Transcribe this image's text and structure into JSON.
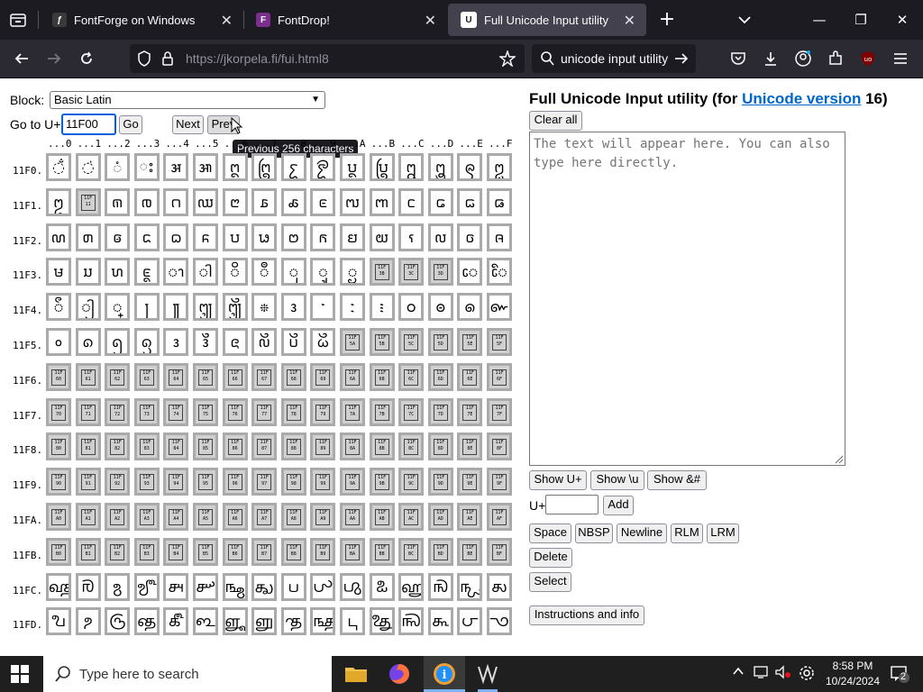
{
  "browser": {
    "tabs": [
      {
        "label": "FontForge on Windows",
        "active": false
      },
      {
        "label": "FontDrop!",
        "active": false
      },
      {
        "label": "Full Unicode Input utility",
        "active": true
      }
    ],
    "url": "https://jkorpela.fi/fui.html8",
    "search_text": "unicode input utility"
  },
  "page": {
    "block_label": "Block:",
    "block_value": "Basic Latin",
    "goto_label": "Go to U+",
    "goto_value": "11F00",
    "go_label": "Go",
    "next_label": "Next",
    "prev_label": "Prev",
    "tooltip": "Previous 256 characters",
    "col_headers": [
      "...0",
      "...1",
      "...2",
      "...3",
      "...4",
      "...5",
      "...6",
      "...7",
      "...8",
      "...9",
      "...A",
      "...B",
      "...C",
      "...D",
      "...E",
      "...F"
    ],
    "rows": [
      {
        "label": "11F0.",
        "chars": [
          "◌̐",
          "◌̇",
          "◌ံ",
          "◌ះ",
          "𑼄",
          "𑼅",
          "𑼆",
          "𑼇",
          "𑼈",
          "𑼉",
          "𑼊",
          "𑼋",
          "𑼌",
          "𑼍",
          "𑼎",
          "𑼏"
        ]
      },
      {
        "label": "11F1.",
        "chars": [
          "𑼐",
          "#11F11",
          "𑼒",
          "𑼓",
          "𑼔",
          "𑼕",
          "𑼖",
          "𑼗",
          "𑼘",
          "𑼙",
          "𑼚",
          "𑼛",
          "𑼜",
          "𑼝",
          "𑼞",
          "𑼟"
        ]
      },
      {
        "label": "11F2.",
        "chars": [
          "𑼠",
          "𑼡",
          "𑼢",
          "𑼣",
          "𑼤",
          "𑼥",
          "𑼦",
          "𑼧",
          "𑼨",
          "𑼩",
          "𑼪",
          "𑼫",
          "𑼬",
          "𑼭",
          "𑼮",
          "𑼯"
        ]
      },
      {
        "label": "11F3.",
        "chars": [
          "𑼰",
          "𑼱",
          "𑼲",
          "𑼳",
          "𑼴",
          "𑼵",
          "𑼶",
          "𑼷",
          "𑼸",
          "𑼹",
          "𑼺",
          "#11F3B",
          "#11F3C",
          "#11F3D",
          "𑼾",
          "𑼿"
        ]
      },
      {
        "label": "11F4.",
        "chars": [
          "𑽀",
          "𑽁",
          "𑽂",
          "𑽃",
          "𑽄",
          "𑽅",
          "𑽆",
          "𑽇",
          "𑽈",
          "𑽉",
          "𑽊",
          "𑽋",
          "𑽌",
          "𑽍",
          "𑽎",
          "𑽏"
        ]
      },
      {
        "label": "11F5.",
        "chars": [
          "𑽐",
          "𑽑",
          "𑽒",
          "𑽓",
          "𑽔",
          "𑽕",
          "𑽖",
          "𑽗",
          "𑽘",
          "𑽙",
          "#11F5A",
          "#11F5B",
          "#11F5C",
          "#11F5D",
          "#11F5E",
          "#11F5F"
        ]
      },
      {
        "label": "11F6.",
        "chars": [
          "#11F60",
          "#11F61",
          "#11F62",
          "#11F63",
          "#11F64",
          "#11F65",
          "#11F66",
          "#11F67",
          "#11F68",
          "#11F69",
          "#11F6A",
          "#11F6B",
          "#11F6C",
          "#11F6D",
          "#11F6E",
          "#11F6F"
        ]
      },
      {
        "label": "11F7.",
        "chars": [
          "#11F70",
          "#11F71",
          "#11F72",
          "#11F73",
          "#11F74",
          "#11F75",
          "#11F76",
          "#11F77",
          "#11F78",
          "#11F79",
          "#11F7A",
          "#11F7B",
          "#11F7C",
          "#11F7D",
          "#11F7E",
          "#11F7F"
        ]
      },
      {
        "label": "11F8.",
        "chars": [
          "#11F80",
          "#11F81",
          "#11F82",
          "#11F83",
          "#11F84",
          "#11F85",
          "#11F86",
          "#11F87",
          "#11F88",
          "#11F89",
          "#11F8A",
          "#11F8B",
          "#11F8C",
          "#11F8D",
          "#11F8E",
          "#11F8F"
        ]
      },
      {
        "label": "11F9.",
        "chars": [
          "#11F90",
          "#11F91",
          "#11F92",
          "#11F93",
          "#11F94",
          "#11F95",
          "#11F96",
          "#11F97",
          "#11F98",
          "#11F99",
          "#11F9A",
          "#11F9B",
          "#11F9C",
          "#11F9D",
          "#11F9E",
          "#11F9F"
        ]
      },
      {
        "label": "11FA.",
        "chars": [
          "#11FA0",
          "#11FA1",
          "#11FA2",
          "#11FA3",
          "#11FA4",
          "#11FA5",
          "#11FA6",
          "#11FA7",
          "#11FA8",
          "#11FA9",
          "#11FAA",
          "#11FAB",
          "#11FAC",
          "#11FAD",
          "#11FAE",
          "#11FAF"
        ]
      },
      {
        "label": "11FB.",
        "chars": [
          "#11FB0",
          "#11FB1",
          "#11FB2",
          "#11FB3",
          "#11FB4",
          "#11FB5",
          "#11FB6",
          "#11FB7",
          "#11FB8",
          "#11FB9",
          "#11FBA",
          "#11FBB",
          "#11FBC",
          "#11FBD",
          "#11FBE",
          "#11FBF"
        ]
      },
      {
        "label": "11FC.",
        "chars": [
          "𑿀",
          "𑿁",
          "𑿂",
          "𑿃",
          "𑿄",
          "𑿅",
          "𑿆",
          "𑿇",
          "𑿈",
          "𑿉",
          "𑿊",
          "𑿋",
          "𑿌",
          "𑿍",
          "𑿎",
          "𑿏"
        ]
      },
      {
        "label": "11FD.",
        "chars": [
          "𑿐",
          "𑿑",
          "𑿒",
          "𑿓",
          "𑿔",
          "𑿕",
          "𑿖",
          "𑿗",
          "𑿘",
          "𑿙",
          "𑿚",
          "𑿛",
          "𑿜",
          "𑿝",
          "𑿞",
          "𑿟"
        ]
      }
    ],
    "title_pre": "Full Unicode Input utility (for ",
    "title_link": "Unicode version",
    "title_post": " 16)",
    "clear_all": "Clear all",
    "textarea_placeholder": "The text will appear here. You can also type here directly.",
    "show_uplus": "Show U+",
    "show_backslash_u": "Show \\u",
    "show_amp": "Show &#",
    "uplus_label": "U+",
    "add_label": "Add",
    "space": "Space",
    "nbsp": "NBSP",
    "newline": "Newline",
    "rlm": "RLM",
    "lrm": "LRM",
    "delete": "Delete",
    "select": "Select",
    "instructions": "Instructions and info"
  },
  "taskbar": {
    "search_placeholder": "Type here to search",
    "time": "8:58 PM",
    "date": "10/24/2024",
    "notification_count": "2"
  },
  "colors": {
    "tab_bar": "#1c1b22",
    "nav_bar": "#2b2a33",
    "link": "#0066cc",
    "focus": "#0060df"
  }
}
